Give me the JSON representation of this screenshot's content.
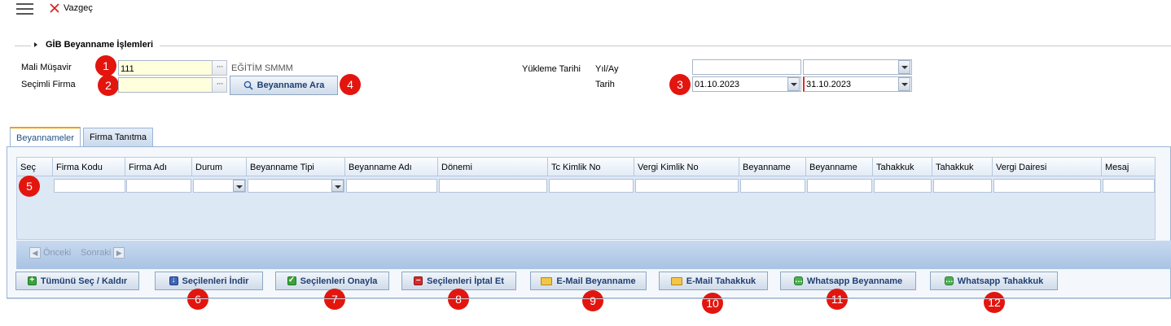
{
  "toolbar": {
    "cancel_label": "Vazgeç"
  },
  "section": {
    "title": "GİB Beyanname İşlemleri"
  },
  "form": {
    "mali_musavir_label": "Mali Müşavir",
    "mali_musavir_value": "111",
    "mali_musavir_name": "EĞİTİM SMMM",
    "secimli_firma_label": "Seçimli Firma",
    "secimli_firma_value": "",
    "search_button_label": "Beyanname Ara",
    "yukleme_tarihi_label": "Yükleme Tarihi",
    "yil_ay_label": "Yıl/Ay",
    "yil_value": "",
    "ay_value": "",
    "tarih_label": "Tarih",
    "date_start": "01.10.2023",
    "date_end": "31.10.2023"
  },
  "tabs": [
    {
      "label": "Beyannameler",
      "active": true
    },
    {
      "label": "Firma Tanıtma",
      "active": false
    }
  ],
  "grid": {
    "columns": [
      "Seç",
      "Firma Kodu",
      "Firma Adı",
      "Durum",
      "Beyanname Tipi",
      "Beyanname Adı",
      "Dönemi",
      "Tc Kimlik No",
      "Vergi Kimlik No",
      "Beyanname",
      "Beyanname",
      "Tahakkuk",
      "Tahakkuk",
      "Vergi Dairesi",
      "Mesaj"
    ],
    "rows": []
  },
  "pager": {
    "prev_label": "Önceki",
    "next_label": "Sonraki"
  },
  "actions": {
    "select_all": "Tümünü Seç / Kaldır",
    "download": "Seçilenleri İndir",
    "approve": "Seçilenleri Onayla",
    "cancel": "Seçilenleri İptal Et",
    "email_beyanname": "E-Mail Beyanname",
    "email_tahakkuk": "E-Mail Tahakkuk",
    "whatsapp_beyanname": "Whatsapp Beyanname",
    "whatsapp_tahakkuk": "Whatsapp Tahakkuk"
  },
  "badges": [
    "1",
    "2",
    "3",
    "4",
    "5",
    "6",
    "7",
    "8",
    "9",
    "10",
    "11",
    "12"
  ],
  "colors": {
    "badge": "#e3150f",
    "input_required": "#ffffde",
    "accent_tab": "#f0a000",
    "button_text": "#1f3f73"
  },
  "icons": {
    "menu": "hamburger-icon",
    "cancel": "close-icon",
    "search": "search-icon",
    "select_all": "plus-icon",
    "download": "download-icon",
    "approve": "check-icon",
    "cancel_selected": "minus-icon",
    "email": "mail-icon",
    "whatsapp": "chat-icon"
  }
}
